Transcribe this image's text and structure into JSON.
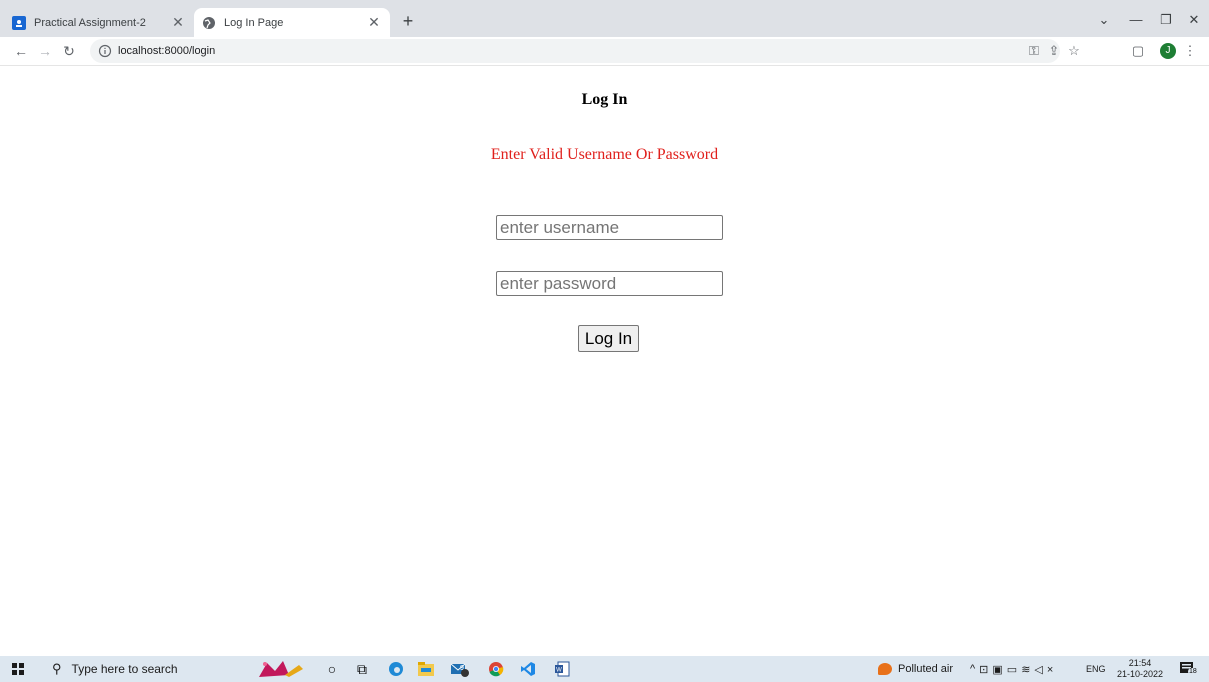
{
  "browser": {
    "tabs": [
      {
        "title": "Practical Assignment-2",
        "active": false
      },
      {
        "title": "Log In Page",
        "active": true
      }
    ],
    "address": "localhost:8000/login"
  },
  "page": {
    "heading": "Log In",
    "error_message": "Enter Valid Username Or Password",
    "username_placeholder": "enter username",
    "password_placeholder": "enter password",
    "submit_label": "Log In",
    "error_color": "#e0201c"
  },
  "taskbar": {
    "search_placeholder": "Type here to search",
    "weather": "Polluted air",
    "language": "ENG",
    "time": "21:54",
    "date": "21-10-2022",
    "notifications_count": "18",
    "mail_badge": "9"
  },
  "icons": {
    "account_avatar_letter": "J"
  }
}
